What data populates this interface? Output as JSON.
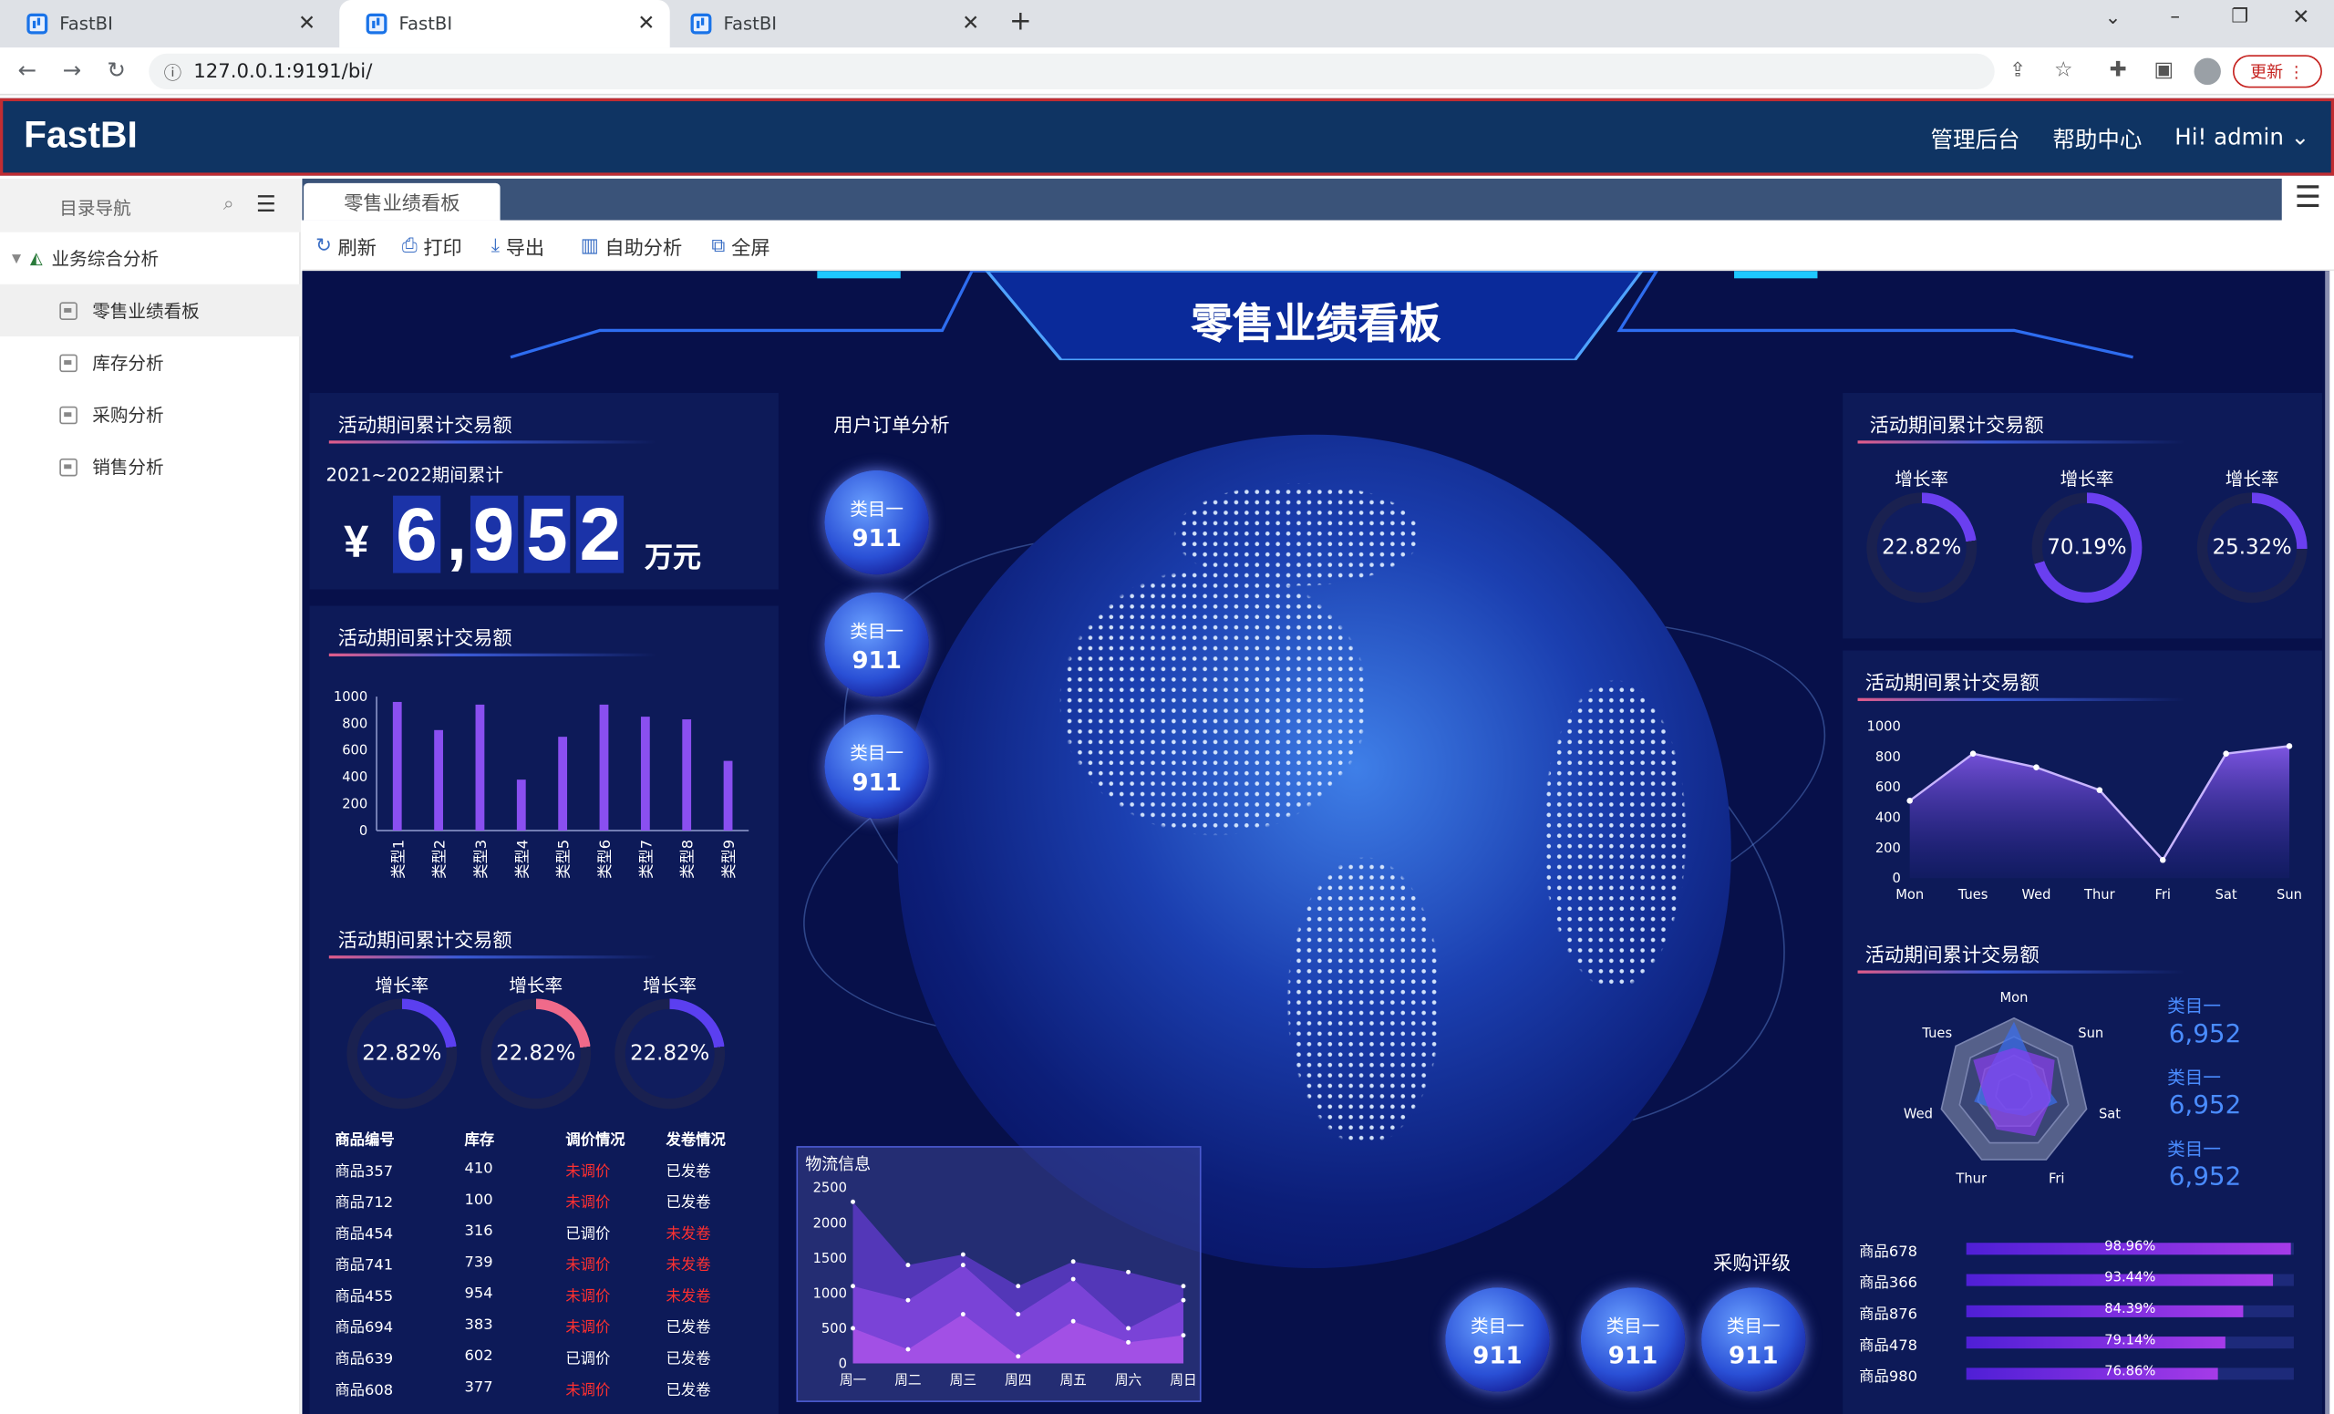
{
  "browser": {
    "tabs": [
      {
        "title": "FastBI"
      },
      {
        "title": "FastBI"
      },
      {
        "title": "FastBI"
      }
    ],
    "url": "127.0.0.1:9191/bi/",
    "update_label": "更新"
  },
  "header": {
    "logo": "FastBI",
    "links": [
      "管理后台",
      "帮助中心"
    ],
    "user": "Hi!  admin"
  },
  "sidebar": {
    "title": "目录导航",
    "group": "业务综合分析",
    "items": [
      "零售业绩看板",
      "库存分析",
      "采购分析",
      "销售分析"
    ]
  },
  "report_tab": "零售业绩看板",
  "toolbar": {
    "refresh": "刷新",
    "print": "打印",
    "export": "导出",
    "self_analysis": "自助分析",
    "fullscreen": "全屏"
  },
  "dashboard": {
    "title": "零售业绩看板",
    "kpi": {
      "title": "活动期间累计交易额",
      "period": "2021~2022期间累计",
      "currency": "¥",
      "digits": [
        "6",
        ",",
        "9",
        "5",
        "2"
      ],
      "unit": "万元"
    },
    "bar_title": "活动期间累计交易额",
    "rings_left_title": "活动期间累计交易额",
    "rings_left": [
      {
        "label": "增长率",
        "text": "22.82%",
        "value": 22.82,
        "color": "#5b3ff0"
      },
      {
        "label": "增长率",
        "text": "22.82%",
        "value": 22.82,
        "color": "#f06a8a"
      },
      {
        "label": "增长率",
        "text": "22.82%",
        "value": 22.82,
        "color": "#5b3ff0"
      }
    ],
    "table": {
      "headers": [
        "商品编号",
        "库存",
        "调价情况",
        "发卷情况"
      ],
      "rows": [
        [
          "商品357",
          "410",
          "未调价",
          "已发卷"
        ],
        [
          "商品712",
          "100",
          "未调价",
          "已发卷"
        ],
        [
          "商品454",
          "316",
          "已调价",
          "未发卷"
        ],
        [
          "商品741",
          "739",
          "未调价",
          "未发卷"
        ],
        [
          "商品455",
          "954",
          "未调价",
          "未发卷"
        ],
        [
          "商品694",
          "383",
          "未调价",
          "已发卷"
        ],
        [
          "商品639",
          "602",
          "已调价",
          "已发卷"
        ],
        [
          "商品608",
          "377",
          "未调价",
          "已发卷"
        ]
      ]
    },
    "orders_title": "用户订单分析",
    "bubbles_left": [
      {
        "label": "类目一",
        "value": "911"
      },
      {
        "label": "类目一",
        "value": "911"
      },
      {
        "label": "类目一",
        "value": "911"
      }
    ],
    "rating_title": "采购评级",
    "bubbles_bottom": [
      {
        "label": "类目一",
        "value": "911"
      },
      {
        "label": "类目一",
        "value": "911"
      },
      {
        "label": "类目一",
        "value": "911"
      }
    ],
    "logistics_title": "物流信息",
    "rings_right_title": "活动期间累计交易额",
    "rings_right": [
      {
        "label": "增长率",
        "text": "22.82%",
        "value": 22.82,
        "color": "#6a3ff0"
      },
      {
        "label": "增长率",
        "text": "70.19%",
        "value": 70.19,
        "color": "#6a3ff0"
      },
      {
        "label": "增长率",
        "text": "25.32%",
        "value": 25.32,
        "color": "#6a3ff0"
      }
    ],
    "line_title": "活动期间累计交易额",
    "radar_title": "活动期间累计交易额",
    "radar_side": [
      {
        "label": "类目一",
        "value": "6,952"
      },
      {
        "label": "类目一",
        "value": "6,952"
      },
      {
        "label": "类目一",
        "value": "6,952"
      }
    ],
    "hbars": [
      {
        "label": "商品678",
        "text": "98.96%",
        "value": 98.96
      },
      {
        "label": "商品366",
        "text": "93.44%",
        "value": 93.44
      },
      {
        "label": "商品876",
        "text": "84.39%",
        "value": 84.39
      },
      {
        "label": "商品478",
        "text": "79.14%",
        "value": 79.14
      },
      {
        "label": "商品980",
        "text": "76.86%",
        "value": 76.86
      }
    ]
  },
  "chart_data": [
    {
      "type": "bar",
      "categories": [
        "类型1",
        "类型2",
        "类型3",
        "类型4",
        "类型5",
        "类型6",
        "类型7",
        "类型8",
        "类型9"
      ],
      "values": [
        960,
        750,
        940,
        380,
        700,
        940,
        850,
        830,
        520
      ],
      "ylim": [
        0,
        1000
      ],
      "yticks": [
        0,
        200,
        400,
        600,
        800,
        1000
      ],
      "color": "#8a4ff0"
    },
    {
      "type": "area",
      "categories": [
        "Mon",
        "Tues",
        "Wed",
        "Thur",
        "Fri",
        "Sat",
        "Sun"
      ],
      "values": [
        510,
        820,
        730,
        580,
        120,
        820,
        870
      ],
      "ylim": [
        0,
        1000
      ],
      "yticks": [
        0,
        200,
        400,
        600,
        800,
        1000
      ]
    },
    {
      "type": "area",
      "categories": [
        "周一",
        "周二",
        "周三",
        "周四",
        "周五",
        "周六",
        "周日"
      ],
      "series": [
        {
          "values": [
            2300,
            1400,
            1550,
            1100,
            1450,
            1300,
            1100
          ]
        },
        {
          "values": [
            1100,
            900,
            1400,
            700,
            1200,
            500,
            900
          ]
        },
        {
          "values": [
            500,
            200,
            700,
            100,
            600,
            300,
            400
          ]
        }
      ],
      "ylim": [
        0,
        2500
      ],
      "yticks": [
        0,
        500,
        1000,
        1500,
        2000,
        2500
      ]
    },
    {
      "type": "radar",
      "indicators": [
        "Mon",
        "Sun",
        "Sat",
        "Fri",
        "Thur",
        "Wed",
        "Tues"
      ],
      "series": [
        {
          "values": [
            95,
            40,
            60,
            35,
            30,
            55,
            45
          ]
        },
        {
          "values": [
            60,
            70,
            50,
            65,
            55,
            40,
            70
          ]
        }
      ],
      "max": 100
    }
  ]
}
